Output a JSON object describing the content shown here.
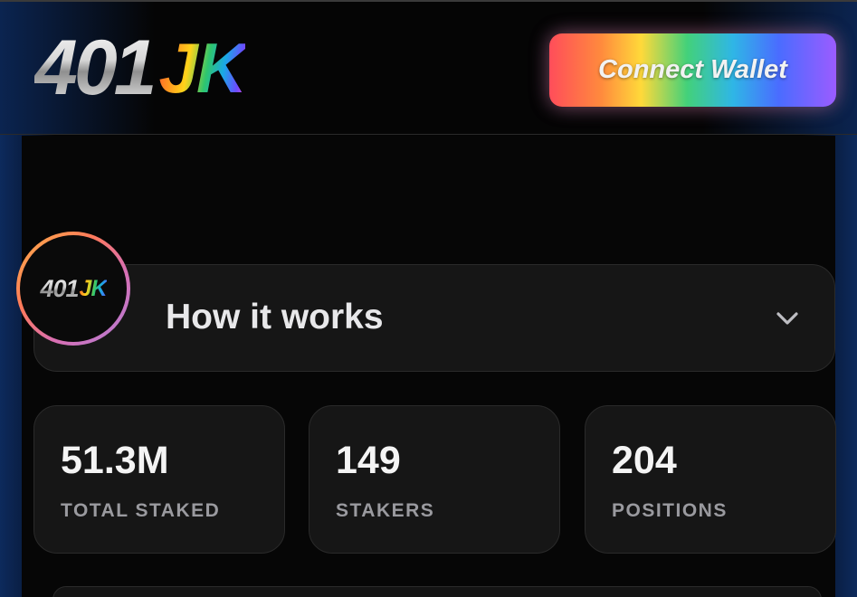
{
  "header": {
    "logo_numbers": "401",
    "logo_letters": "JK",
    "connect_wallet_label": "Connect Wallet"
  },
  "accordion": {
    "title": "How it works",
    "avatar_numbers": "401",
    "avatar_letters": "JK",
    "chevron_icon": "chevron-down-icon"
  },
  "stats": [
    {
      "value": "51.3M",
      "label": "TOTAL STAKED"
    },
    {
      "value": "149",
      "label": "STAKERS"
    },
    {
      "value": "204",
      "label": "POSITIONS"
    }
  ],
  "colors": {
    "background": "#050505",
    "card": "#161616",
    "card_border": "#2a2a2a",
    "label": "#9a9a9f",
    "side_glow": "#0d2a5c"
  }
}
